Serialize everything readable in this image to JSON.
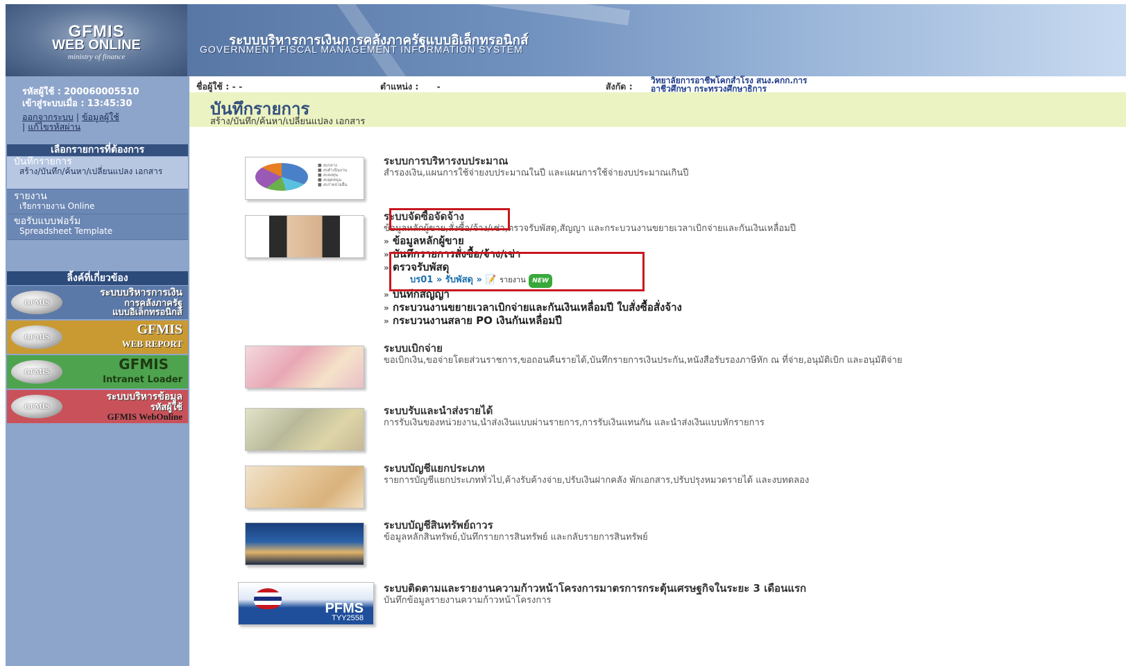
{
  "header": {
    "logo_line1": "GFMIS",
    "logo_line2": "WEB ONLINE",
    "logo_line3": "ministry of finance",
    "title_th": "ระบบบริหารการเงินการคลังภาครัฐแบบอิเล็กทรอนิกส์",
    "title_en": "GOVERNMENT FISCAL MANAGEMENT INFORMATION SYSTEM"
  },
  "user": {
    "id_label": "รหัสผู้ใช้ :",
    "id_value": "200060005510",
    "login_label": "เข้าสู่ระบบเมื่อ :",
    "login_value": "13:45:30",
    "logout": "ออกจากระบบ",
    "profile": "ข้อมูลผู้ใช้",
    "change_pw": "แก้ไขรหัสผ่าน",
    "name_label": "ชื่อผู้ใช้ :",
    "name_value": "- -",
    "position_label": "ตำแหน่ง :",
    "position_value": "-",
    "dept_label": "สังกัด :",
    "dept_line1": "วิทยาลัยการอาชีพโคกสำโรง สนง.คกก.การ",
    "dept_line2": "อาชีวศึกษา กระทรวงศึกษาธิการ"
  },
  "sidebar": {
    "menu_title": "เลือกรายการที่ต้องการ",
    "menu": [
      {
        "title": "บันทึกรายการ",
        "sub": "สร้าง/บันทึก/ค้นหา/เปลี่ยนแปลง เอกสาร"
      },
      {
        "title": "รายงาน",
        "sub": "เรียกรายงาน Online"
      },
      {
        "title": "ขอรับแบบฟอร์ม",
        "sub": "Spreadsheet Template"
      }
    ],
    "related_title": "ลิ้งค์ที่เกี่ยวข้อง",
    "links": [
      {
        "emblem": "GFMIS",
        "l1": "ระบบบริหารการเงิน",
        "l2": "การคลังภาครัฐ",
        "l3": "แบบอิเล็กทรอนิกส์",
        "color": "#5b79a8"
      },
      {
        "emblem": "GFMIS",
        "l1": "GFMIS",
        "l2": "WEB REPORT",
        "l3": "",
        "color": "#c99a32"
      },
      {
        "emblem": "GFMIS",
        "l1": "GFMIS",
        "l2": "Intranet Loader",
        "l3": "",
        "color": "#4ea34e"
      },
      {
        "emblem": "GFMIS",
        "l1": "ระบบบริหารข้อมูล",
        "l2": "รหัสผู้ใช้",
        "l3": "GFMIS WebOnline",
        "color": "#c9525a"
      }
    ]
  },
  "page": {
    "title": "บันทึกรายการ",
    "subtitle": "สร้าง/บันทึก/ค้นหา/เปลี่ยนแปลง เอกสาร"
  },
  "items": [
    {
      "title": "ระบบการบริหารงบประมาณ",
      "desc": "สำรองเงิน,แผนการใช้จ่ายงบประมาณในปี และแผนการใช้จ่ายงบประมาณเกินปี"
    },
    {
      "title": "ระบบจัดซื้อจัดจ้าง",
      "desc": "ข้อมูลหลักผู้ขาย,สั่งซื้อ/จ้าง/เช่า,ตรวจรับพัสดุ,สัญญา และกระบวนงานขยายเวลาเบิกจ่ายและกันเงินเหลื่อมปี",
      "subs": [
        "ข้อมูลหลักผู้ขาย",
        "บันทึกรายการสั่งซื้อ/จ้าง/เช่า",
        "ตรวจรับพัสดุ",
        "บันทึกสัญญา",
        "กระบวนงานขยายเวลาเบิกจ่ายและกันเงินเหลื่อมปี ใบสั่งซื้อสั่งจ้าง",
        "กระบวนงานสลาย PO เงินกันเหลื่อมปี"
      ],
      "path": {
        "code": "บร01",
        "step": "รับพัสดุ",
        "report": "รายงาน",
        "badge": "NEW"
      }
    },
    {
      "title": "ระบบเบิกจ่าย",
      "desc": "ขอเบิกเงิน,ขอจ่ายโดยส่วนราชการ,ขอถอนคืนรายได้,บันทึกรายการเงินประกัน,หนังสือรับรองภาษีหัก ณ ที่จ่าย,อนุมัติเบิก และอนุมัติจ่าย"
    },
    {
      "title": "ระบบรับและนำส่งรายได้",
      "desc": "การรับเงินของหน่วยงาน,นำส่งเงินแบบผ่านรายการ,การรับเงินแทนกัน และนำส่งเงินแบบหักรายการ"
    },
    {
      "title": "ระบบบัญชีแยกประเภท",
      "desc": "รายการบัญชีแยกประเภททั่วไป,ค้างรับค้างจ่าย,ปรับเงินฝากคลัง พักเอกสาร,ปรับปรุงหมวดรายได้ และงบทดลอง"
    },
    {
      "title": "ระบบบัญชีสินทรัพย์ถาวร",
      "desc": "ข้อมูลหลักสินทรัพย์,บันทึกรายการสินทรัพย์ และกลับรายการสินทรัพย์"
    },
    {
      "title": "ระบบติดตามและรายงานความก้าวหน้าโครงการมาตรการกระตุ้นเศรษฐกิจในระยะ 3 เดือนแรก",
      "desc": "บันทึกข้อมูลรายงานความก้าวหน้าโครงการ",
      "badge_text": "PFMS",
      "badge_sub": "TYY2558"
    }
  ],
  "pie_legend": [
    "งบกลาง",
    "งบดำเนินงาน",
    "งบลงทุน",
    "งบอุดหนุน",
    "งบรายจ่ายอื่น"
  ]
}
